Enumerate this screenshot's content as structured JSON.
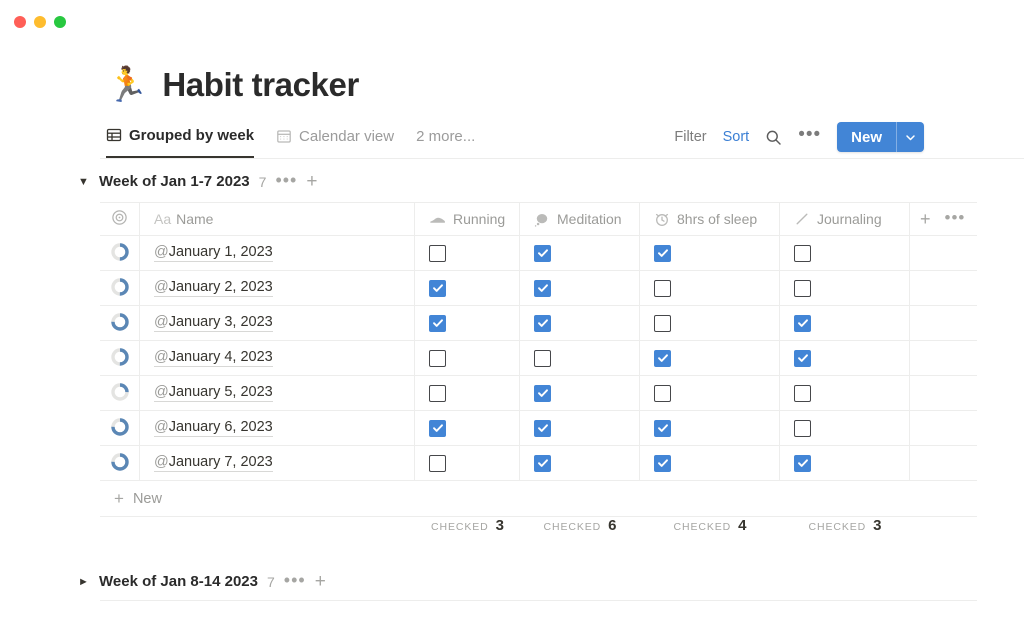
{
  "window": {
    "traffic_lights": [
      {
        "name": "close",
        "color": "#FF5F57"
      },
      {
        "name": "minimize",
        "color": "#FEBC2E"
      },
      {
        "name": "maximize",
        "color": "#28C840"
      }
    ]
  },
  "header": {
    "emoji": "🏃",
    "title": "Habit tracker"
  },
  "tabs": [
    {
      "label": "Grouped by week",
      "icon": "table-icon",
      "active": true
    },
    {
      "label": "Calendar view",
      "icon": "calendar-icon",
      "active": false
    }
  ],
  "tabs_more": "2 more...",
  "toolbar": {
    "filter_label": "Filter",
    "sort_label": "Sort",
    "search_icon": "search-icon",
    "more_icon": "ellipsis-icon",
    "new_label": "New",
    "new_caret_icon": "chevron-down-icon",
    "accent_color": "#3B7FD4",
    "new_button_color": "#4285D6"
  },
  "columns": {
    "icon_header": "target-icon",
    "name_prefix": "Aa",
    "name_label": "Name",
    "habits": [
      {
        "label": "Running",
        "icon": "shoe-icon"
      },
      {
        "label": "Meditation",
        "icon": "thought-bubble-icon"
      },
      {
        "label": "8hrs of sleep",
        "icon": "alarm-clock-icon"
      },
      {
        "label": "Journaling",
        "icon": "pencil-icon"
      }
    ],
    "add_column_icon": "plus-icon",
    "column_options_icon": "ellipsis-icon"
  },
  "groups": [
    {
      "name": "Week of Jan 1-7 2023",
      "count": "7",
      "expanded": true,
      "caret": "▼",
      "options_icon": "ellipsis-icon",
      "add_icon": "plus-icon",
      "rows": [
        {
          "name": "@January 1, 2023",
          "checks": [
            false,
            true,
            true,
            false
          ],
          "progress": 50
        },
        {
          "name": "@January 2, 2023",
          "checks": [
            true,
            true,
            false,
            false
          ],
          "progress": 50
        },
        {
          "name": "@January 3, 2023",
          "checks": [
            true,
            true,
            false,
            true
          ],
          "progress": 75
        },
        {
          "name": "@January 4, 2023",
          "checks": [
            false,
            false,
            true,
            true
          ],
          "progress": 50
        },
        {
          "name": "@January 5, 2023",
          "checks": [
            false,
            true,
            false,
            false
          ],
          "progress": 25
        },
        {
          "name": "@January 6, 2023",
          "checks": [
            true,
            true,
            true,
            false
          ],
          "progress": 75
        },
        {
          "name": "@January 7, 2023",
          "checks": [
            false,
            true,
            true,
            true
          ],
          "progress": 75
        }
      ],
      "new_row_label": "New",
      "summary_label": "Checked",
      "summaries": [
        "3",
        "6",
        "4",
        "3"
      ]
    },
    {
      "name": "Week of Jan 8-14 2023",
      "count": "7",
      "expanded": false,
      "caret": "►",
      "options_icon": "ellipsis-icon",
      "add_icon": "plus-icon"
    }
  ]
}
